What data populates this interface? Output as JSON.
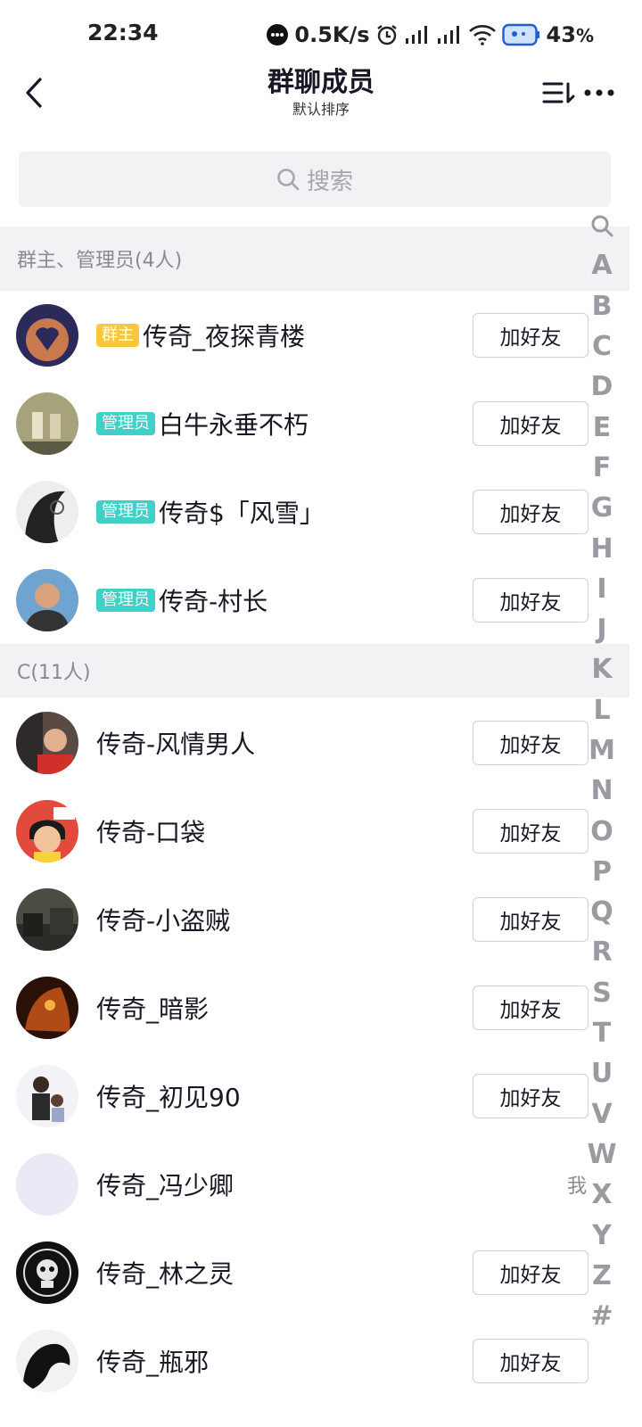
{
  "status_bar": {
    "time": "22:34",
    "net_speed": "0.5K/s",
    "battery": "43",
    "battery_unit": "%"
  },
  "nav": {
    "title": "群聊成员",
    "subtitle": "默认排序"
  },
  "search": {
    "placeholder": "搜索"
  },
  "sections": [
    {
      "title": "群主、管理员(4人)",
      "members": [
        {
          "badge": "群主",
          "badge_type": "owner",
          "name": "传奇_夜探青楼",
          "action": "加好友",
          "avatar_color": "#b5552f"
        },
        {
          "badge": "管理员",
          "badge_type": "admin",
          "name": "白牛永垂不朽",
          "action": "加好友",
          "avatar_color": "#7d7b5b"
        },
        {
          "badge": "管理员",
          "badge_type": "admin",
          "name": "传奇$「风雪」",
          "action": "加好友",
          "avatar_color": "#3a3a3a"
        },
        {
          "badge": "管理员",
          "badge_type": "admin",
          "name": "传奇-村长",
          "action": "加好友",
          "avatar_color": "#4a7ea8"
        }
      ]
    },
    {
      "title": "C(11人)",
      "members": [
        {
          "name": "传奇-风情男人",
          "action": "加好友",
          "avatar_color": "#6b5b55"
        },
        {
          "name": "传奇-口袋",
          "action": "加好友",
          "avatar_color": "#d8403a"
        },
        {
          "name": "传奇-小盗贼",
          "action": "加好友",
          "avatar_color": "#3d3f38"
        },
        {
          "name": "传奇_暗影",
          "action": "加好友",
          "avatar_color": "#8a3a18"
        },
        {
          "name": "传奇_初见90",
          "action": "加好友",
          "avatar_color": "#e9e6ee"
        },
        {
          "name": "传奇_冯少卿",
          "self_tag": "我",
          "avatar_color": "#ece9f6"
        },
        {
          "name": "传奇_林之灵",
          "action": "加好友",
          "avatar_color": "#111111"
        },
        {
          "name": "传奇_瓶邪",
          "action": "加好友",
          "avatar_color": "#222222"
        }
      ]
    }
  ],
  "alpha_index": [
    "A",
    "B",
    "C",
    "D",
    "E",
    "F",
    "G",
    "H",
    "I",
    "J",
    "K",
    "L",
    "M",
    "N",
    "O",
    "P",
    "Q",
    "R",
    "S",
    "T",
    "U",
    "V",
    "W",
    "X",
    "Y",
    "Z",
    "#"
  ]
}
